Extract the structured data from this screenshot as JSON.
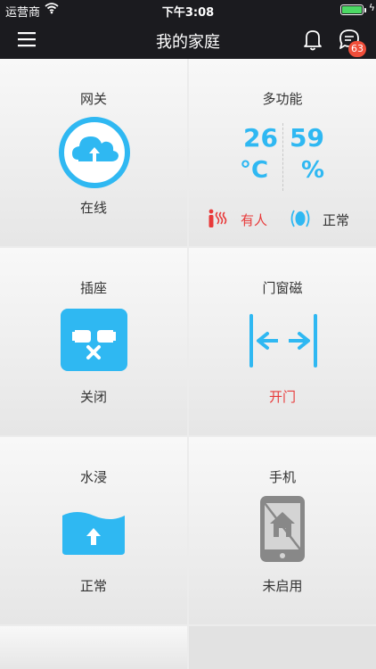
{
  "status_bar": {
    "carrier": "运营商",
    "time": "下午3:08"
  },
  "nav": {
    "title": "我的家庭",
    "badge_count": "63"
  },
  "tiles": {
    "gateway": {
      "label": "网关",
      "state": "在线"
    },
    "multi": {
      "label": "多功能",
      "temperature": "26",
      "temperature_unit": "°C",
      "humidity": "59",
      "humidity_unit": "%",
      "presence": "有人",
      "status": "正常"
    },
    "socket": {
      "label": "插座",
      "state": "关闭"
    },
    "door": {
      "label": "门窗磁",
      "state": "开门"
    },
    "water": {
      "label": "水浸",
      "state": "正常"
    },
    "phone": {
      "label": "手机",
      "state": "未启用"
    }
  },
  "colors": {
    "accent": "#2fb8f2",
    "alert": "#e83a3a",
    "nav_bg": "#1b1b1f",
    "badge": "#f04e3a"
  }
}
